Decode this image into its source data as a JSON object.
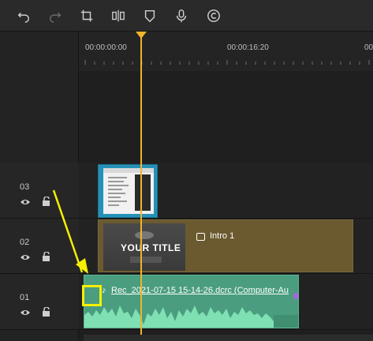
{
  "toolbar": {
    "icons": [
      "undo-icon",
      "redo-icon",
      "crop-icon",
      "split-icon",
      "marker-icon",
      "mic-icon",
      "copyright-icon"
    ]
  },
  "ruler": {
    "timecode_start": "00:00:00:00",
    "timecode_mid": "00:00:16:20",
    "timecode_end": "00"
  },
  "tracks": [
    {
      "number": "03"
    },
    {
      "number": "02"
    },
    {
      "number": "01"
    }
  ],
  "clips": {
    "intro_label": "Intro 1",
    "title_text": "YOUR TITLE",
    "rec_label": "Rec_2021-07-15 15-14-26.dcrc (Computer-Au"
  },
  "colors": {
    "playhead": "#f0b429",
    "annotation": "#f6f000",
    "screen_clip": "#2591b8",
    "title_clip": "#6b5a2f",
    "audio_clip": "#4a9d7f"
  }
}
